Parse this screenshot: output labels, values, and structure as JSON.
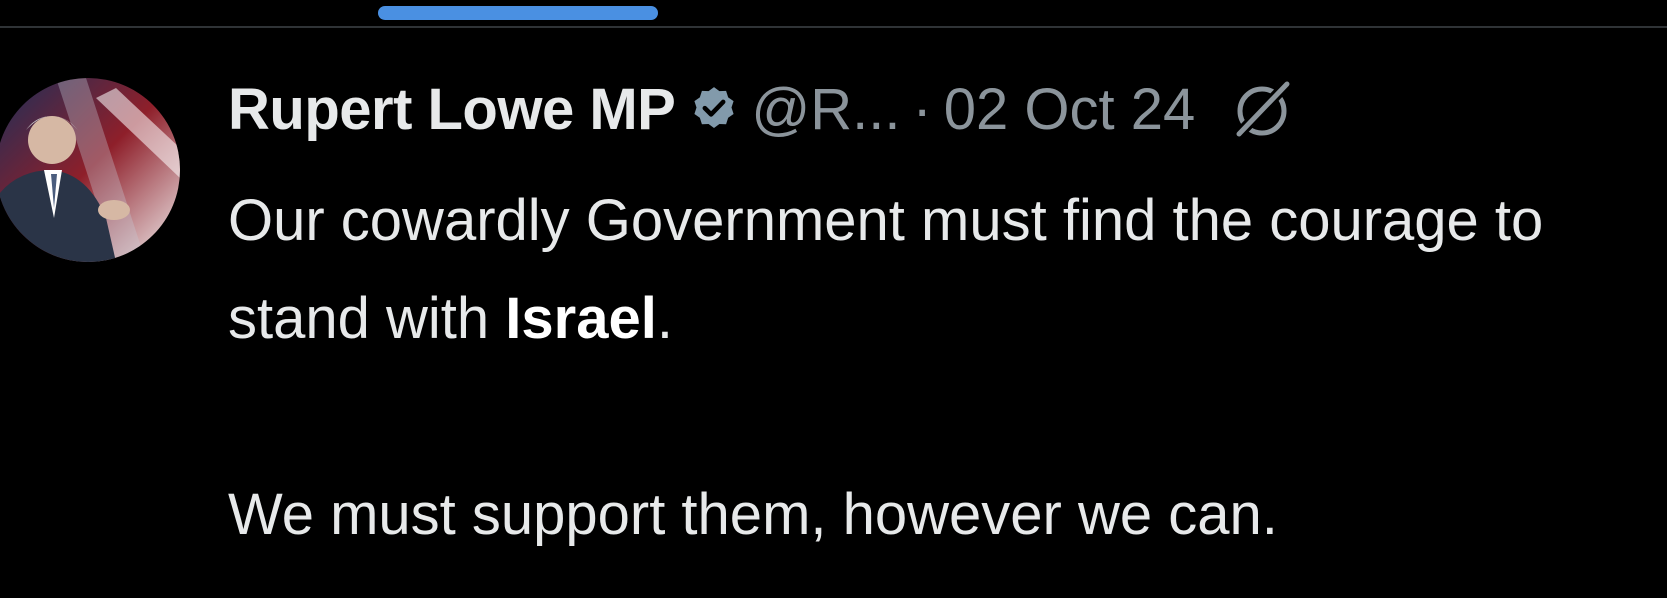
{
  "colors": {
    "background": "#000000",
    "tab_indicator": "#4a90e2",
    "verified_badge": "#829aab",
    "text_primary": "#e7e9ea",
    "text_secondary": "#8b949b"
  },
  "tweet": {
    "display_name": "Rupert Lowe MP",
    "verified_icon": "verified-badge-icon",
    "handle": "@R...",
    "separator": "·",
    "date": "02 Oct 24",
    "action_icon": "grok-icon",
    "body": {
      "line1_text": "Our cowardly Government must find the courage to stand with ",
      "line1_bold": "Israel",
      "line1_end": ".",
      "paragraph2": "We must support them, however we can."
    }
  }
}
